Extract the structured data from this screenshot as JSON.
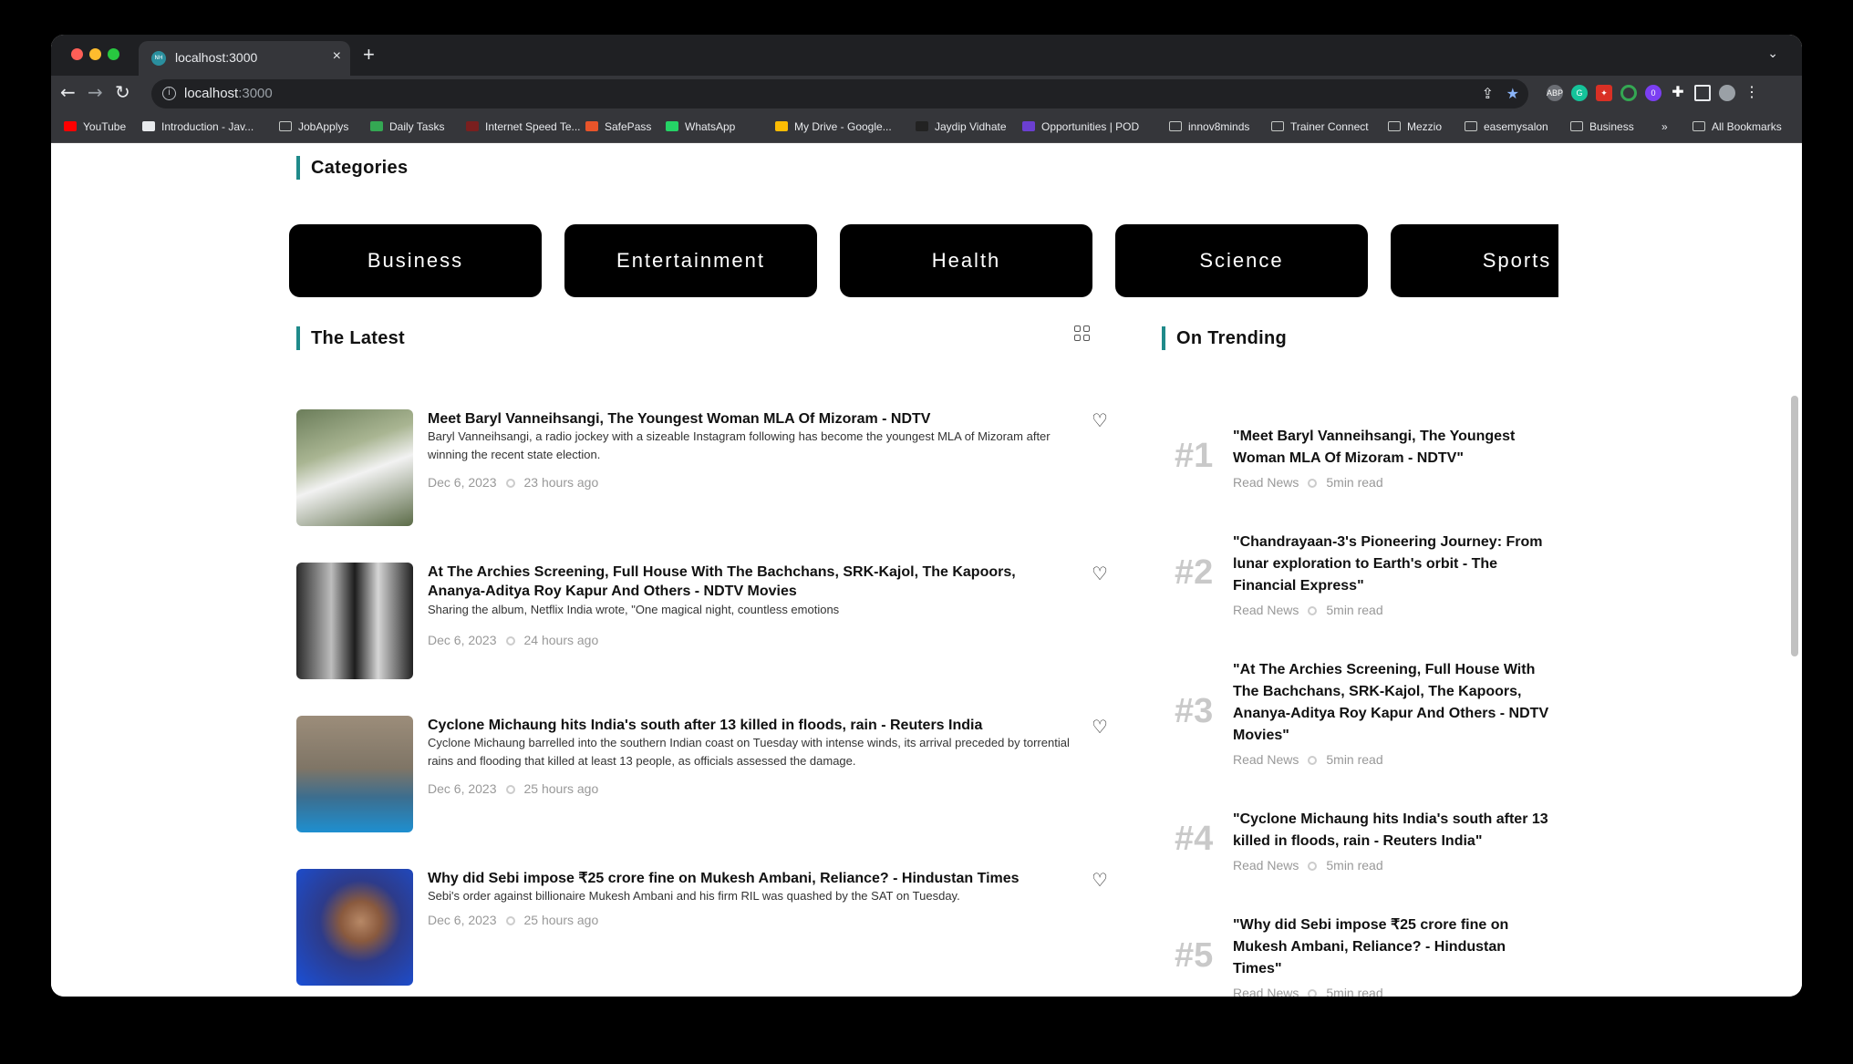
{
  "browser": {
    "tab_title": "localhost:3000",
    "favicon_text": "NH",
    "url_host": "localhost",
    "url_port": ":3000",
    "bookmarks": [
      {
        "label": "YouTube",
        "icon": "youtube-icon",
        "color": "#ff0000"
      },
      {
        "label": "Introduction - Jav...",
        "icon": "m-logo-icon",
        "color": "#e8eaed"
      },
      {
        "label": "JobApplys",
        "icon": "folder-icon",
        "color": "folder"
      },
      {
        "label": "Daily Tasks",
        "icon": "drive-icon",
        "color": "#34a853"
      },
      {
        "label": "Internet Speed Te...",
        "icon": "speedtest-icon",
        "color": "#7a1f1f"
      },
      {
        "label": "SafePass",
        "icon": "shield-icon",
        "color": "#e8542a"
      },
      {
        "label": "WhatsApp",
        "icon": "whatsapp-icon",
        "color": "#25d366"
      },
      {
        "label": "My Drive - Google...",
        "icon": "drive-icon",
        "color": "#fbbc04"
      },
      {
        "label": "Jaydip Vidhate",
        "icon": "jv-logo-icon",
        "color": "#222222"
      },
      {
        "label": "Opportunities | POD",
        "icon": "pod-icon",
        "color": "#6b3fd1"
      },
      {
        "label": "innov8minds",
        "icon": "folder-icon",
        "color": "folder"
      },
      {
        "label": "Trainer Connect",
        "icon": "folder-icon",
        "color": "folder"
      },
      {
        "label": "Mezzio",
        "icon": "folder-icon",
        "color": "folder"
      },
      {
        "label": "easemysalon",
        "icon": "folder-icon",
        "color": "folder"
      },
      {
        "label": "Business",
        "icon": "folder-icon",
        "color": "folder"
      }
    ],
    "overflow_label": "»",
    "all_bookmarks": "All Bookmarks",
    "ext_badge": "0"
  },
  "categories": {
    "title": "Categories",
    "items": [
      "Business",
      "Entertainment",
      "Health",
      "Science",
      "Sports"
    ]
  },
  "latest": {
    "title": "The Latest",
    "articles": [
      {
        "title": "Meet Baryl Vanneihsangi, The Youngest Woman MLA Of Mizoram - NDTV",
        "desc": "Baryl Vanneihsangi, a radio jockey with a sizeable Instagram following has become the youngest MLA of Mizoram after winning the recent state election.",
        "date": "Dec 6, 2023",
        "ago": "23 hours ago"
      },
      {
        "title": "At The Archies Screening, Full House With The Bachchans, SRK-Kajol, The Kapoors, Ananya-Aditya Roy Kapur And Others - NDTV Movies",
        "desc": "Sharing the album, Netflix India wrote, \"One magical night, countless emotions",
        "date": "Dec 6, 2023",
        "ago": "24 hours ago"
      },
      {
        "title": "Cyclone Michaung hits India's south after 13 killed in floods, rain - Reuters India",
        "desc": "Cyclone Michaung barrelled into the southern Indian coast on Tuesday with intense winds, its arrival preceded by torrential rains and flooding that killed at least 13 people, as officials assessed the damage.",
        "date": "Dec 6, 2023",
        "ago": "25 hours ago"
      },
      {
        "title": "Why did Sebi impose ₹25 crore fine on Mukesh Ambani, Reliance? - Hindustan Times",
        "desc": "Sebi's order against billionaire Mukesh Ambani and his firm RIL was quashed by the SAT on Tuesday.",
        "date": "Dec 6, 2023",
        "ago": "25 hours ago"
      }
    ]
  },
  "trending": {
    "title": "On Trending",
    "items": [
      {
        "rank": "#1",
        "title": "\"Meet Baryl Vanneihsangi, The Youngest Woman MLA Of Mizoram - NDTV\"",
        "link": "Read News",
        "read": "5min read"
      },
      {
        "rank": "#2",
        "title": "\"Chandrayaan-3's Pioneering Journey: From lunar exploration to Earth's orbit - The Financial Express\"",
        "link": "Read News",
        "read": "5min read"
      },
      {
        "rank": "#3",
        "title": "\"At The Archies Screening, Full House With The Bachchans, SRK-Kajol, The Kapoors, Ananya-Aditya Roy Kapur And Others - NDTV Movies\"",
        "link": "Read News",
        "read": "5min read"
      },
      {
        "rank": "#4",
        "title": "\"Cyclone Michaung hits India's south after 13 killed in floods, rain - Reuters India\"",
        "link": "Read News",
        "read": "5min read"
      },
      {
        "rank": "#5",
        "title": "\"Why did Sebi impose ₹25 crore fine on Mukesh Ambani, Reliance? - Hindustan Times\"",
        "link": "Read News",
        "read": "5min read"
      }
    ]
  },
  "colors": {
    "accent": "#1f8a8a",
    "card": "#000000"
  }
}
